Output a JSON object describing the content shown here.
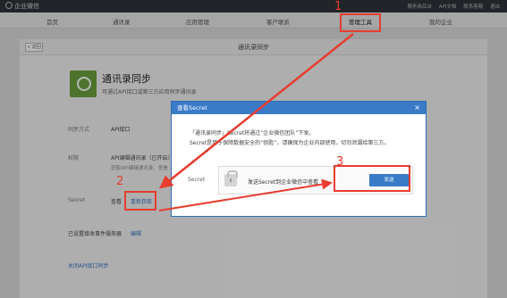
{
  "topbar": {
    "brand": "企业微信",
    "links": [
      "服务商后台",
      "API文档",
      "联系客服",
      "退出"
    ]
  },
  "nav": {
    "items": [
      "首页",
      "通讯录",
      "应用管理",
      "客户联系",
      "管理工具",
      "我的企业"
    ]
  },
  "page": {
    "back_label": "< 返回",
    "title": "通讯录同步",
    "app_title": "通讯录同步",
    "app_desc": "可通过API接口或第三方应用同步通讯录",
    "sync_method_label": "同步方式",
    "sync_method_value": "API接口",
    "permission_label": "权限",
    "permission_value": "API编辑通讯录（已开启）",
    "permission_sub": "获取API编辑通讯录、查看",
    "secret_label": "Secret",
    "secret_view": "查看",
    "secret_refetch": "重新获取",
    "callback_text": "已设置接收事件服务器",
    "callback_edit": "编辑",
    "close_sync": "关闭API接口同步"
  },
  "modal": {
    "title": "查看Secret",
    "close_glyph": "×",
    "line1": "「通讯录同步」Secret将通过“企业微信团队”下发。",
    "line2": "Secret是用于保障数据安全的“钥匙”，请确保为企业内部使用，切勿泄漏给第三方。",
    "secret_label": "Secret",
    "send_text": "发送Secret到企业微信中查看",
    "send_button": "发送"
  },
  "annotations": {
    "markers": [
      "1",
      "2",
      "3"
    ],
    "color": "#e83c2f"
  },
  "colors": {
    "accent": "#3a7bc8",
    "app_icon": "#6aa13d"
  }
}
